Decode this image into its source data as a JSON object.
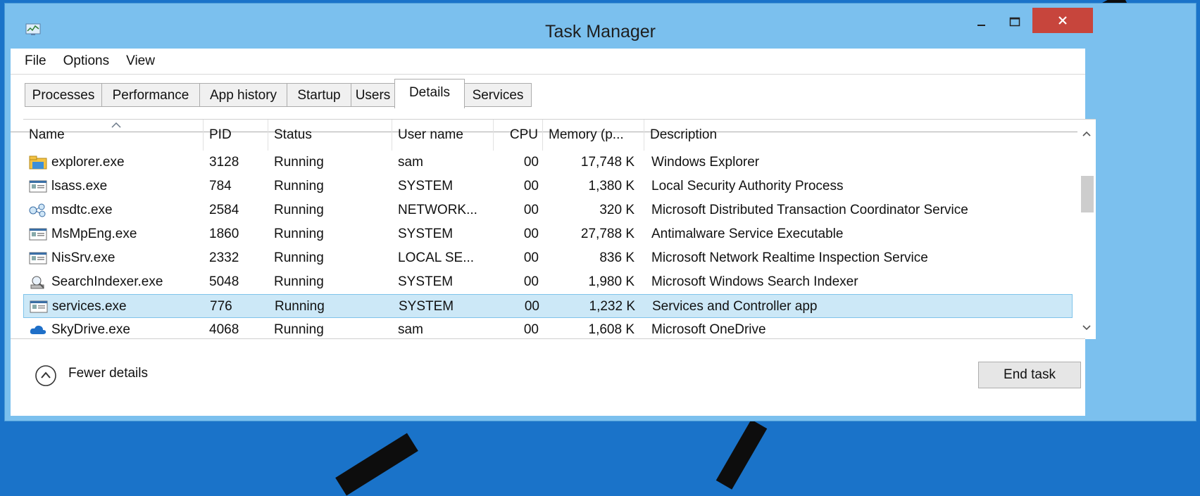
{
  "window": {
    "title": "Task Manager"
  },
  "menu": [
    "File",
    "Options",
    "View"
  ],
  "tabs": [
    "Processes",
    "Performance",
    "App history",
    "Startup",
    "Users",
    "Details",
    "Services"
  ],
  "active_tab": "Details",
  "columns": [
    "Name",
    "PID",
    "Status",
    "User name",
    "CPU",
    "Memory (p...",
    "Description"
  ],
  "sort_column": "Name",
  "rows": [
    {
      "name": "explorer.exe",
      "pid": "3128",
      "status": "Running",
      "user": "sam",
      "cpu": "00",
      "memory": "17,748 K",
      "description": "Windows Explorer",
      "icon": "folder-icon"
    },
    {
      "name": "lsass.exe",
      "pid": "784",
      "status": "Running",
      "user": "SYSTEM",
      "cpu": "00",
      "memory": "1,380 K",
      "description": "Local Security Authority Process",
      "icon": "window-app-icon"
    },
    {
      "name": "msdtc.exe",
      "pid": "2584",
      "status": "Running",
      "user": "NETWORK...",
      "cpu": "00",
      "memory": "320 K",
      "description": "Microsoft Distributed Transaction Coordinator Service",
      "icon": "network-nodes-icon"
    },
    {
      "name": "MsMpEng.exe",
      "pid": "1860",
      "status": "Running",
      "user": "SYSTEM",
      "cpu": "00",
      "memory": "27,788 K",
      "description": "Antimalware Service Executable",
      "icon": "window-app-icon"
    },
    {
      "name": "NisSrv.exe",
      "pid": "2332",
      "status": "Running",
      "user": "LOCAL SE...",
      "cpu": "00",
      "memory": "836 K",
      "description": "Microsoft Network Realtime Inspection Service",
      "icon": "window-app-icon"
    },
    {
      "name": "SearchIndexer.exe",
      "pid": "5048",
      "status": "Running",
      "user": "SYSTEM",
      "cpu": "00",
      "memory": "1,980 K",
      "description": "Microsoft Windows Search Indexer",
      "icon": "search-indexer-icon"
    },
    {
      "name": "services.exe",
      "pid": "776",
      "status": "Running",
      "user": "SYSTEM",
      "cpu": "00",
      "memory": "1,232 K",
      "description": "Services and Controller app",
      "icon": "window-app-icon",
      "selected": true
    },
    {
      "name": "SkyDrive.exe",
      "pid": "4068",
      "status": "Running",
      "user": "sam",
      "cpu": "00",
      "memory": "1,608 K",
      "description": "Microsoft OneDrive",
      "icon": "cloud-icon"
    }
  ],
  "footer": {
    "fewer_details": "Fewer details",
    "end_task": "End task"
  },
  "colors": {
    "titlebar": "#7bc0ee",
    "close_button": "#c7453c",
    "selection": "#cce8f7",
    "desktop": "#1a73c9"
  }
}
